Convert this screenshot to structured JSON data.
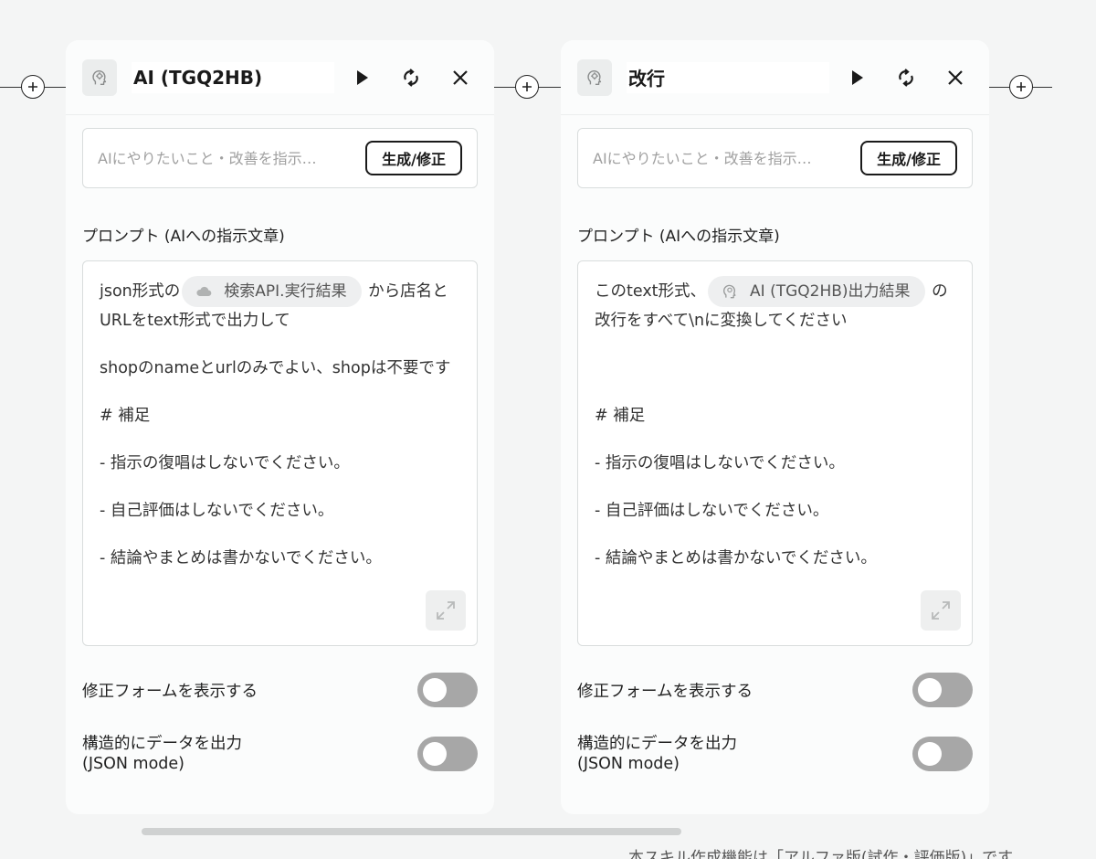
{
  "cards": [
    {
      "title": "AI (TGQ2HB)",
      "instruct_placeholder": "AIにやりたいこと・改善を指示…",
      "generate_label": "生成/修正",
      "prompt_label": "プロンプト (AIへの指示文章)",
      "prompt": {
        "line1_before": "json形式の",
        "chip": "検索API.実行結果",
        "line1_after": "から店名とURLをtext形式で出力して",
        "para2": "shopのnameとurlのみでよい、shopは不要です",
        "heading": "# 補足",
        "bullets": [
          "- 指示の復唱はしないでください。",
          "- 自己評価はしないでください。",
          "- 結論やまとめは書かないでください。"
        ]
      },
      "toggle1_label": "修正フォームを表示する",
      "toggle2_label_line1": "構造的にデータを出力",
      "toggle2_label_line2": "(JSON mode)"
    },
    {
      "title": "改行",
      "instruct_placeholder": "AIにやりたいこと・改善を指示…",
      "generate_label": "生成/修正",
      "prompt_label": "プロンプト (AIへの指示文章)",
      "prompt": {
        "line1_before": "このtext形式、",
        "chip": "AI (TGQ2HB)出力結果",
        "line1_after": "の改行をすべて\\nに変換してください",
        "heading": "# 補足",
        "bullets": [
          "- 指示の復唱はしないでください。",
          "- 自己評価はしないでください。",
          "- 結論やまとめは書かないでください。"
        ]
      },
      "toggle1_label": "修正フォームを表示する",
      "toggle2_label_line1": "構造的にデータを出力",
      "toggle2_label_line2": "(JSON mode)"
    }
  ],
  "footer_note": "本スキル作成機能は「アルファ版(試作・評価版)」です",
  "icons": [
    "plus-circle-icon",
    "ai-head-icon",
    "play-icon",
    "refresh-icon",
    "close-icon",
    "cloud-icon",
    "expand-icon"
  ],
  "colors": {
    "background": "#f4f5f5",
    "card": "#fbfcfc",
    "toggle_off": "#a7a7a7",
    "chip": "#eeeff0"
  },
  "toggles": {
    "card1_show_form": false,
    "card1_json_mode": false,
    "card2_show_form": false,
    "card2_json_mode": false
  }
}
